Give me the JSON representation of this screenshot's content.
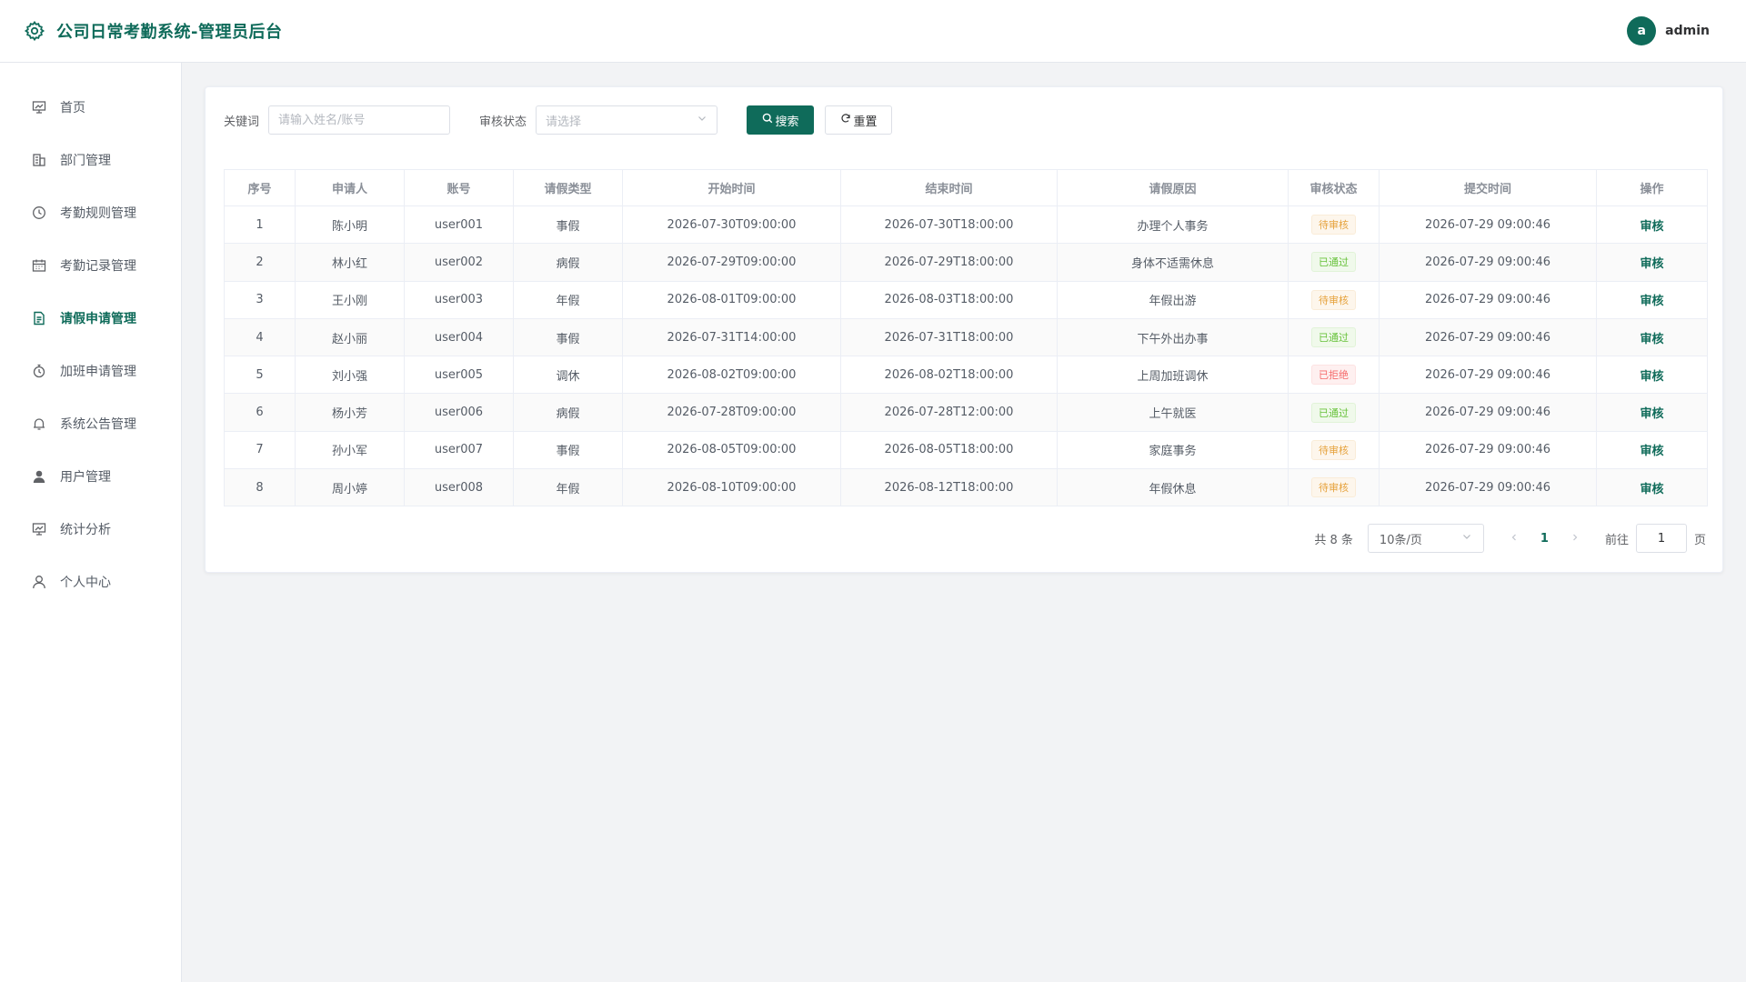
{
  "header": {
    "title": "公司日常考勤系统-管理员后台",
    "avatar_letter": "a",
    "username": "admin"
  },
  "sidebar": {
    "items": [
      {
        "label": "首页",
        "icon": "dashboard-icon",
        "active": false
      },
      {
        "label": "部门管理",
        "icon": "building-icon",
        "active": false
      },
      {
        "label": "考勤规则管理",
        "icon": "clock-icon",
        "active": false
      },
      {
        "label": "考勤记录管理",
        "icon": "calendar-icon",
        "active": false
      },
      {
        "label": "请假申请管理",
        "icon": "document-icon",
        "active": true
      },
      {
        "label": "加班申请管理",
        "icon": "stopwatch-icon",
        "active": false
      },
      {
        "label": "系统公告管理",
        "icon": "bell-icon",
        "active": false
      },
      {
        "label": "用户管理",
        "icon": "user-filled-icon",
        "active": false
      },
      {
        "label": "统计分析",
        "icon": "chart-board-icon",
        "active": false
      },
      {
        "label": "个人中心",
        "icon": "user-outline-icon",
        "active": false
      }
    ]
  },
  "filters": {
    "keyword_label": "关键词",
    "keyword_placeholder": "请输入姓名/账号",
    "keyword_value": "",
    "status_label": "审核状态",
    "status_placeholder": "请选择",
    "search_label": "搜索",
    "reset_label": "重置"
  },
  "table": {
    "columns": [
      "序号",
      "申请人",
      "账号",
      "请假类型",
      "开始时间",
      "结束时间",
      "请假原因",
      "审核状态",
      "提交时间",
      "操作"
    ],
    "rows": [
      {
        "no": "1",
        "name": "陈小明",
        "account": "user001",
        "type": "事假",
        "start": "2026-07-30T09:00:00",
        "end": "2026-07-30T18:00:00",
        "reason": "办理个人事务",
        "status": "待审核",
        "status_kind": "pending",
        "submitted": "2026-07-29 09:00:46",
        "action": "审核"
      },
      {
        "no": "2",
        "name": "林小红",
        "account": "user002",
        "type": "病假",
        "start": "2026-07-29T09:00:00",
        "end": "2026-07-29T18:00:00",
        "reason": "身体不适需休息",
        "status": "已通过",
        "status_kind": "approved",
        "submitted": "2026-07-29 09:00:46",
        "action": "审核"
      },
      {
        "no": "3",
        "name": "王小刚",
        "account": "user003",
        "type": "年假",
        "start": "2026-08-01T09:00:00",
        "end": "2026-08-03T18:00:00",
        "reason": "年假出游",
        "status": "待审核",
        "status_kind": "pending",
        "submitted": "2026-07-29 09:00:46",
        "action": "审核"
      },
      {
        "no": "4",
        "name": "赵小丽",
        "account": "user004",
        "type": "事假",
        "start": "2026-07-31T14:00:00",
        "end": "2026-07-31T18:00:00",
        "reason": "下午外出办事",
        "status": "已通过",
        "status_kind": "approved",
        "submitted": "2026-07-29 09:00:46",
        "action": "审核"
      },
      {
        "no": "5",
        "name": "刘小强",
        "account": "user005",
        "type": "调休",
        "start": "2026-08-02T09:00:00",
        "end": "2026-08-02T18:00:00",
        "reason": "上周加班调休",
        "status": "已拒绝",
        "status_kind": "rejected",
        "submitted": "2026-07-29 09:00:46",
        "action": "审核"
      },
      {
        "no": "6",
        "name": "杨小芳",
        "account": "user006",
        "type": "病假",
        "start": "2026-07-28T09:00:00",
        "end": "2026-07-28T12:00:00",
        "reason": "上午就医",
        "status": "已通过",
        "status_kind": "approved",
        "submitted": "2026-07-29 09:00:46",
        "action": "审核"
      },
      {
        "no": "7",
        "name": "孙小军",
        "account": "user007",
        "type": "事假",
        "start": "2026-08-05T09:00:00",
        "end": "2026-08-05T18:00:00",
        "reason": "家庭事务",
        "status": "待审核",
        "status_kind": "pending",
        "submitted": "2026-07-29 09:00:46",
        "action": "审核"
      },
      {
        "no": "8",
        "name": "周小婷",
        "account": "user008",
        "type": "年假",
        "start": "2026-08-10T09:00:00",
        "end": "2026-08-12T18:00:00",
        "reason": "年假休息",
        "status": "待审核",
        "status_kind": "pending",
        "submitted": "2026-07-29 09:00:46",
        "action": "审核"
      }
    ]
  },
  "pagination": {
    "total_text": "共 8 条",
    "page_size": "10条/页",
    "current_page": "1",
    "goto_label": "前往",
    "goto_value": "1",
    "page_suffix": "页"
  },
  "colors": {
    "primary": "#0f6b5a",
    "pending": "#e6a23c",
    "approved": "#67c23a",
    "rejected": "#f56c6c"
  }
}
